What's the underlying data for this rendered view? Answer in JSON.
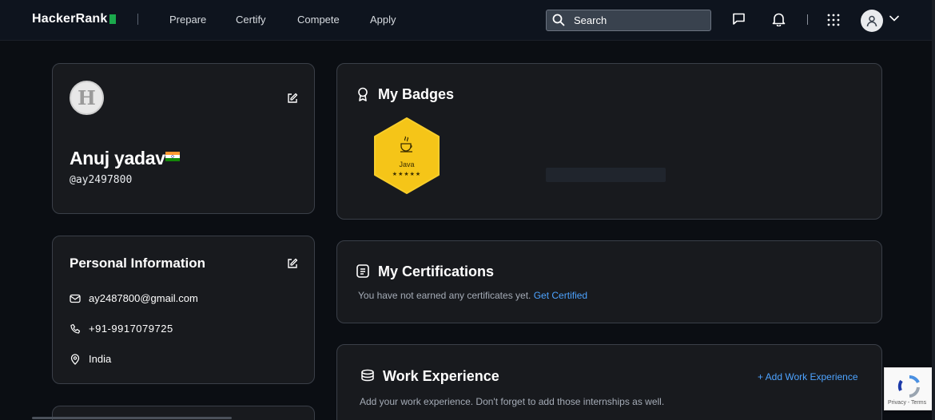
{
  "nav": {
    "logo": "HackerRank",
    "links": [
      "Prepare",
      "Certify",
      "Compete",
      "Apply"
    ],
    "search_placeholder": "Search"
  },
  "profile": {
    "name": "Anuj yadav",
    "username": "@ay2497800",
    "avatar_letter": "H"
  },
  "personal_info": {
    "title": "Personal Information",
    "email": "ay2487800@gmail.com",
    "phone": "+91-9917079725",
    "location": "India"
  },
  "badges": {
    "title": "My Badges",
    "items": [
      {
        "label": "Java",
        "stars": "★★★★★"
      }
    ]
  },
  "certifications": {
    "title": "My Certifications",
    "empty_text": "You have not earned any certificates yet.",
    "link": "Get Certified"
  },
  "work_experience": {
    "title": "Work Experience",
    "add_link": "+ Add Work Experience",
    "empty_text": "Add your work experience. Don't forget to add those internships as well."
  },
  "recaptcha": {
    "text": "Privacy - Terms"
  },
  "colors": {
    "background": "#0b0e13",
    "card": "#181a1e",
    "link": "#4da3ff",
    "badge_gold": "#f5c518",
    "brand_green": "#1ba94c"
  }
}
